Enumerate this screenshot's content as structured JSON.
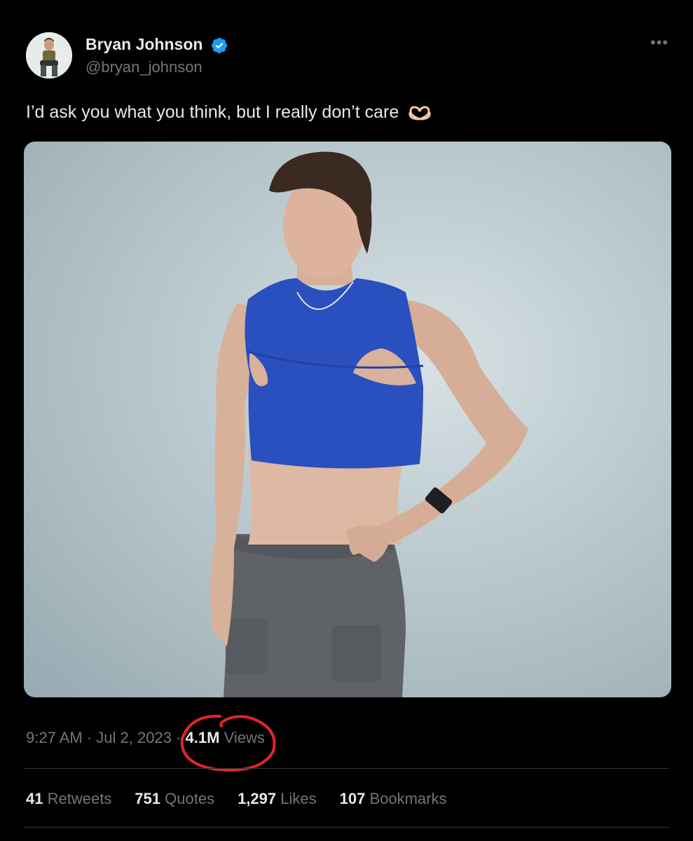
{
  "author": {
    "name": "Bryan Johnson",
    "handle": "@bryan_johnson",
    "verified": true,
    "verified_color": "#1d9bf0"
  },
  "more_icon": "more-horizontal-icon",
  "tweet": {
    "text": "I’d ask you what you think, but I really don’t care",
    "emoji": "heart-hands-icon"
  },
  "meta": {
    "time": "9:27 AM",
    "date": "Jul 2, 2023",
    "views_count": "4.1M",
    "views_label": "Views",
    "annotation_color": "#e0242b"
  },
  "stats": [
    {
      "count": "41",
      "label": "Retweets"
    },
    {
      "count": "751",
      "label": "Quotes"
    },
    {
      "count": "1,297",
      "label": "Likes"
    },
    {
      "count": "107",
      "label": "Bookmarks"
    }
  ],
  "colors": {
    "background": "#000000",
    "text_primary": "#e7e9ea",
    "text_secondary": "#71767b",
    "divider": "#2f3336",
    "shirt": "#2a4fbf",
    "pants": "#5f6266"
  }
}
